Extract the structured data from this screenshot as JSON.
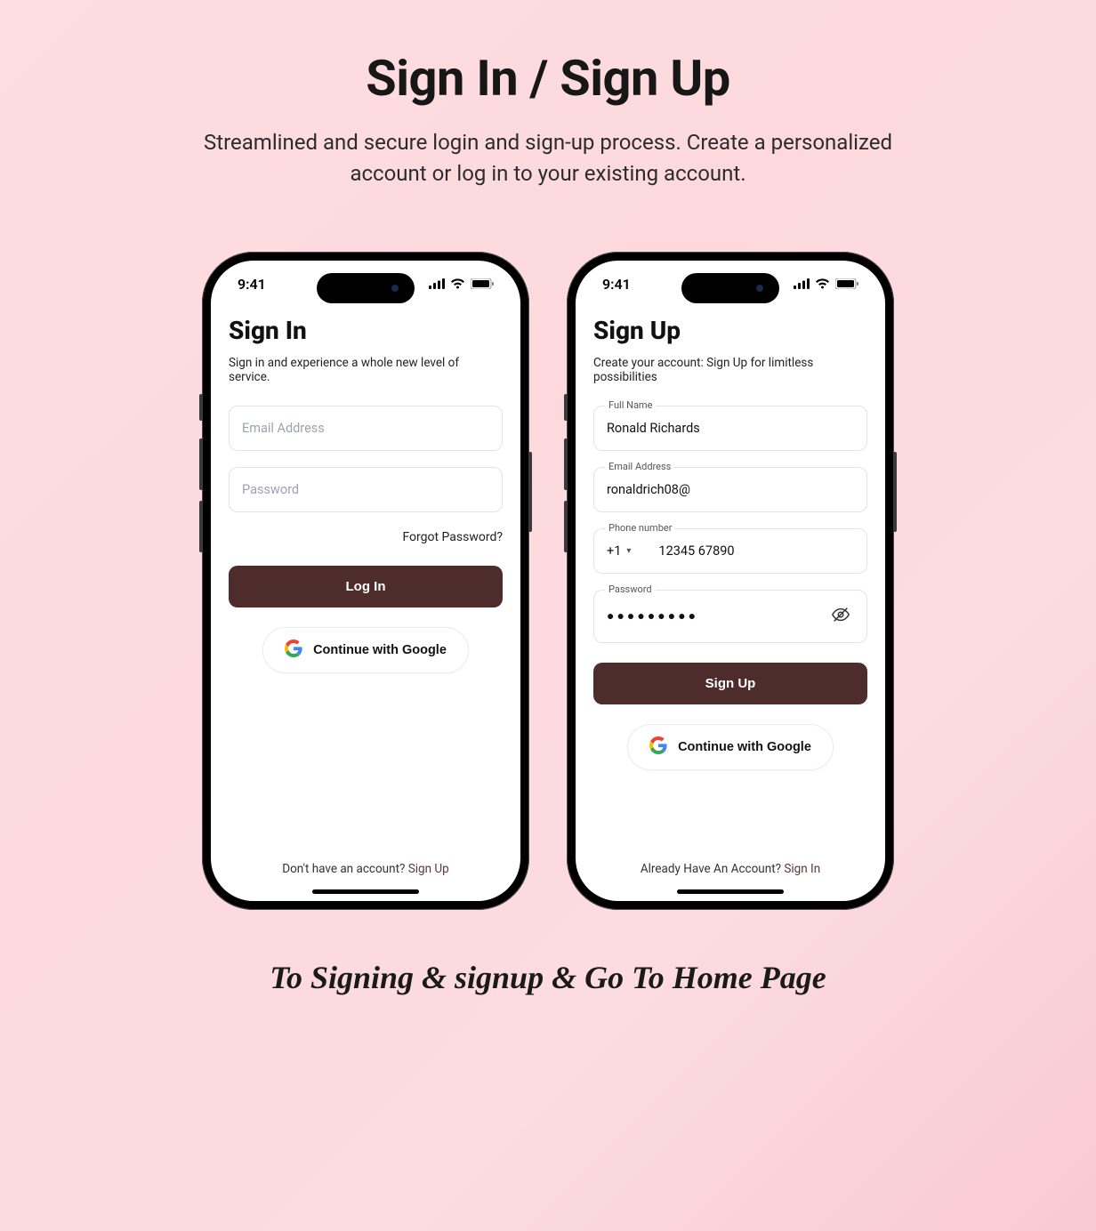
{
  "header": {
    "title": "Sign In / Sign Up",
    "subtitle": "Streamlined and secure login and sign-up process. Create a personalized account or log in to your existing account."
  },
  "status": {
    "time": "9:41"
  },
  "signin": {
    "title": "Sign In",
    "subtitle": "Sign in and experience a whole new level of service.",
    "email_placeholder": "Email Address",
    "password_placeholder": "Password",
    "forgot": "Forgot Password?",
    "login_btn": "Log In",
    "google_btn": "Continue with Google",
    "footer_text": "Don't have an account? ",
    "footer_link": "Sign Up"
  },
  "signup": {
    "title": "Sign Up",
    "subtitle": "Create your account: Sign Up for limitless possibilities",
    "fullname_label": "Full Name",
    "fullname_value": "Ronald Richards",
    "email_label": "Email Address",
    "email_value": "ronaldrich08@",
    "phone_label": "Phone number",
    "phone_cc": "+1",
    "phone_value": "12345 67890",
    "password_label": "Password",
    "password_value": "●●●●●●●●●",
    "signup_btn": "Sign Up",
    "google_btn": "Continue with Google",
    "footer_text": "Already Have An Account? ",
    "footer_link": "Sign In"
  },
  "caption": "To Signing & signup & Go To Home Page"
}
